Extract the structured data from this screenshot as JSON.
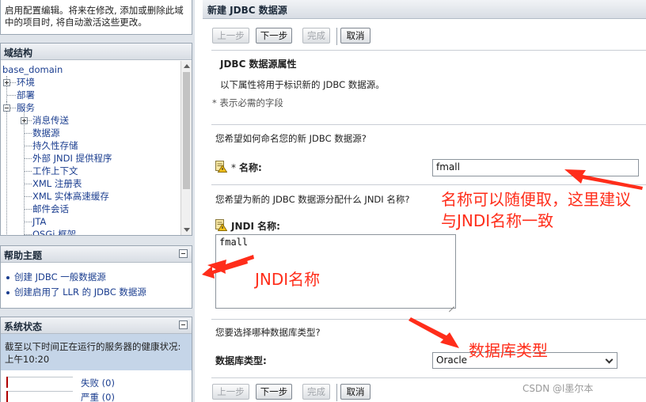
{
  "change_center": {
    "text": "启用配置编辑。将来在修改, 添加或删除此域中的项目时, 将自动激活这些更改。"
  },
  "domain_structure": {
    "title": "域结构",
    "root": "base_domain",
    "items": [
      {
        "label": "环境"
      },
      {
        "label": "部署"
      },
      {
        "label": "服务"
      },
      {
        "label": "消息传送"
      },
      {
        "label": "数据源"
      },
      {
        "label": "持久性存储"
      },
      {
        "label": "外部 JNDI 提供程序"
      },
      {
        "label": "工作上下文"
      },
      {
        "label": "XML 注册表"
      },
      {
        "label": "XML 实体高速缓存"
      },
      {
        "label": "邮件会话"
      },
      {
        "label": "JTA"
      },
      {
        "label": "OSGi 框架"
      }
    ]
  },
  "help": {
    "title": "帮助主题",
    "items": [
      {
        "label": "创建 JDBC 一般数据源"
      },
      {
        "label": "创建启用了 LLR 的 JDBC 数据源"
      }
    ]
  },
  "system_status": {
    "title": "系统状态",
    "description": "截至以下时间正在运行的服务器的健康状况: 上午10:20",
    "rows": [
      {
        "label": "失败 (0)"
      },
      {
        "label": "严重 (0)"
      }
    ]
  },
  "wizard": {
    "title": "新建 JDBC 数据源",
    "buttons": {
      "back": "上一步",
      "next": "下一步",
      "finish": "完成",
      "cancel": "取消"
    },
    "section_title": "JDBC 数据源属性",
    "section_desc": "以下属性将用于标识新的 JDBC 数据源。",
    "required_note": "* 表示必需的字段",
    "q_name": "您希望如何命名您的新 JDBC 数据源?",
    "name_star": "*",
    "name_label": "名称:",
    "name_value": "fmall",
    "q_jndi": "您希望为新的 JDBC 数据源分配什么 JNDI 名称?",
    "jndi_label": "JNDI 名称:",
    "jndi_value": "fmall",
    "q_dbtype": "您要选择哪种数据库类型?",
    "dbtype_label": "数据库类型:",
    "dbtype_value": "Oracle"
  },
  "annotations": {
    "name_note_line1": "名称可以随便取，这里建议",
    "name_note_line2": "与JNDI名称一致",
    "jndi_note": "JNDI名称",
    "dbtype_note": "数据库类型",
    "color": "#ff2d1a"
  },
  "watermark": "CSDN @l墨尔本"
}
